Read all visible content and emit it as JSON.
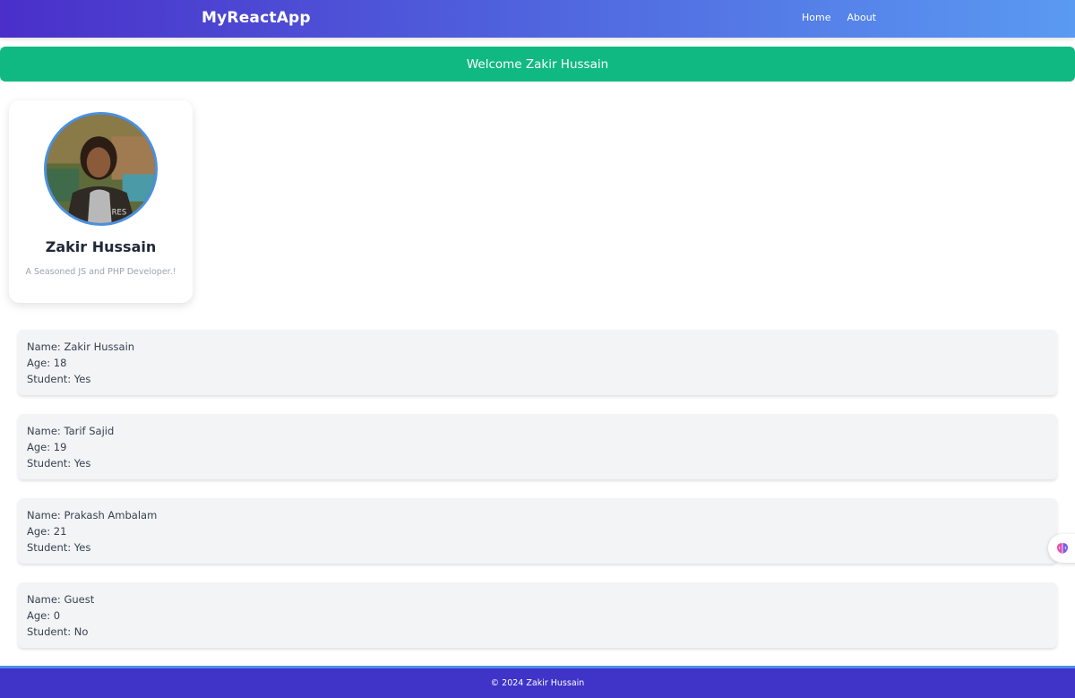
{
  "header": {
    "brand": "MyReactApp",
    "nav": [
      {
        "label": "Home"
      },
      {
        "label": "About"
      }
    ]
  },
  "welcome": {
    "text": "Welcome Zakir Hussain"
  },
  "profile": {
    "name": "Zakir Hussain",
    "bio": "A Seasoned JS and PHP Developer.!"
  },
  "people": [
    {
      "name": "Name: Zakir Hussain",
      "age": "Age: 18",
      "student": "Student: Yes"
    },
    {
      "name": "Name: Tarif Sajid",
      "age": "Age: 19",
      "student": "Student: Yes"
    },
    {
      "name": "Name: Prakash Ambalam",
      "age": "Age: 21",
      "student": "Student: Yes"
    },
    {
      "name": "Name: Guest",
      "age": "Age: 0",
      "student": "Student: No"
    }
  ],
  "footer": {
    "text": "© 2024 Zakir Hussain"
  },
  "colors": {
    "header_gradient_start": "#4a2fc9",
    "header_gradient_end": "#5a9af2",
    "welcome_bg": "#10b981",
    "footer_bg": "#3f33c8",
    "card_bg": "#f3f4f6"
  },
  "icons": {
    "side_widget": "brain-icon"
  }
}
